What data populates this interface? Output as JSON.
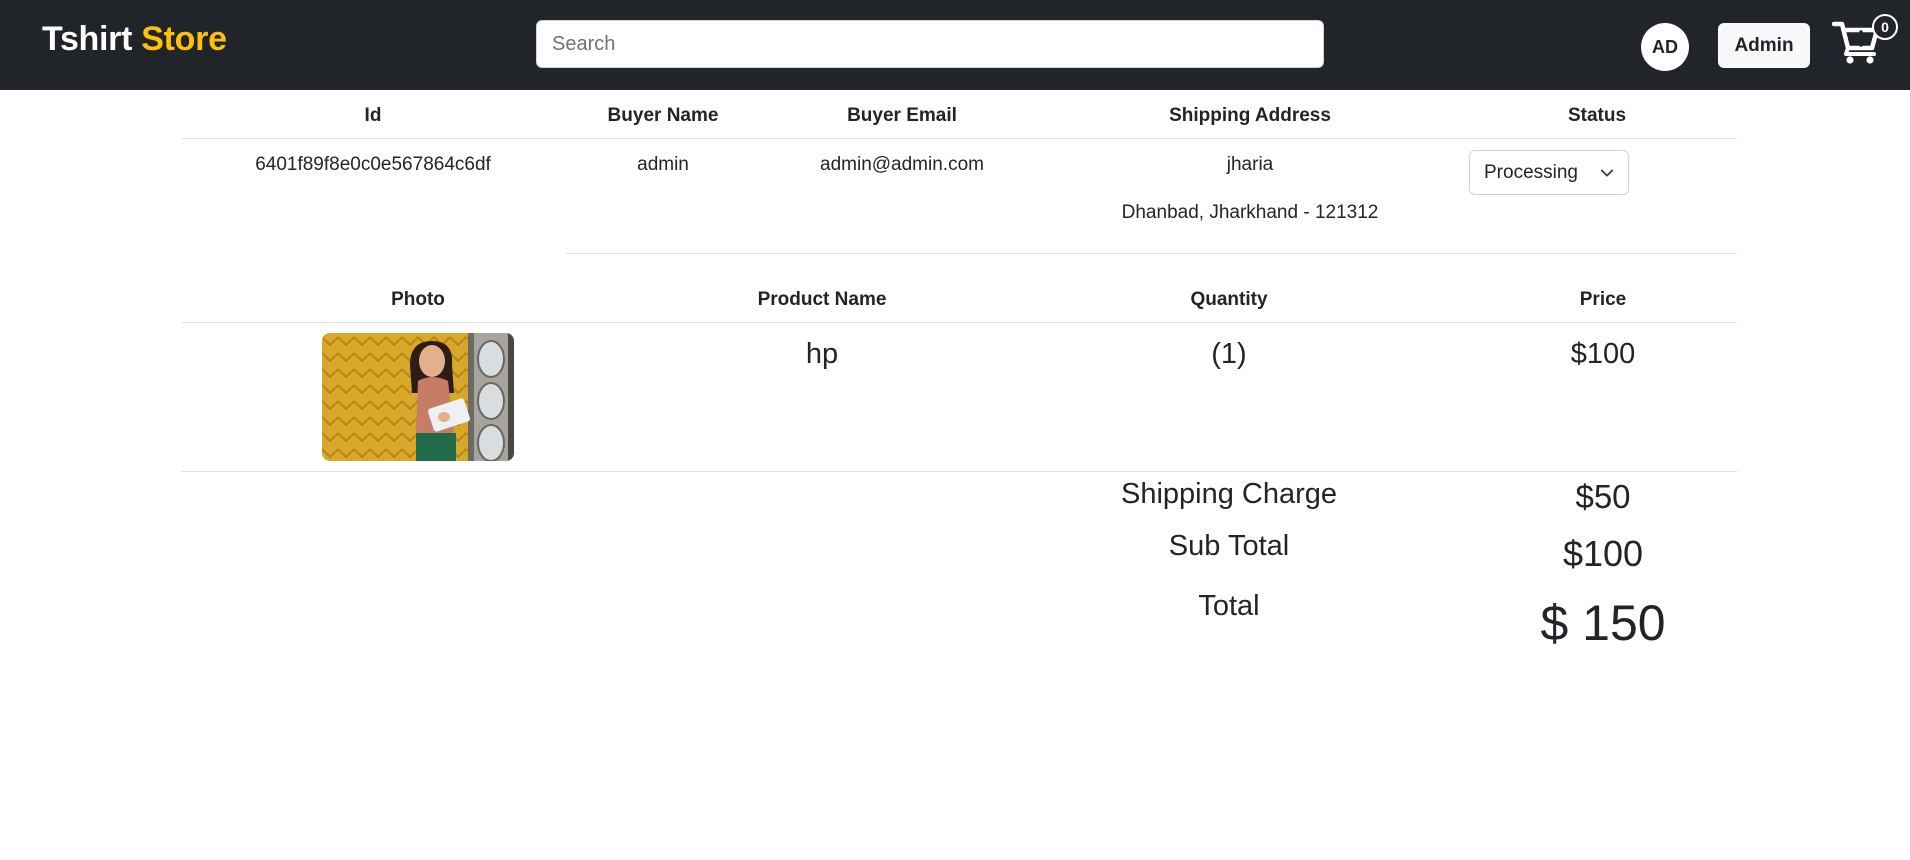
{
  "navbar": {
    "brand_main": "Tshirt",
    "brand_accent": "Store",
    "search_placeholder": "Search",
    "avatar_initials": "AD",
    "admin_label": "Admin",
    "cart_count": "0",
    "colors": {
      "background": "#212529",
      "accent": "#ffc107"
    }
  },
  "order_table": {
    "headers": [
      "Id",
      "Buyer Name",
      "Buyer Email",
      "Shipping Address",
      "Status"
    ],
    "row": {
      "id": "6401f89f8e0c0e567864c6df",
      "buyer_name": "admin",
      "buyer_email": "admin@admin.com",
      "address_line1": "jharia",
      "address_line2": "Dhanbad, Jharkhand - 121312",
      "status": "Processing"
    }
  },
  "items_table": {
    "headers": [
      "Photo",
      "Product Name",
      "Quantity",
      "Price"
    ],
    "items": [
      {
        "product_name": "hp",
        "quantity": "(1)",
        "price": "$100"
      }
    ]
  },
  "summary": {
    "shipping_label": "Shipping Charge",
    "shipping_value": "$50",
    "subtotal_label": "Sub Total",
    "subtotal_value": "$100",
    "total_label": "Total",
    "total_value": "$ 150"
  }
}
